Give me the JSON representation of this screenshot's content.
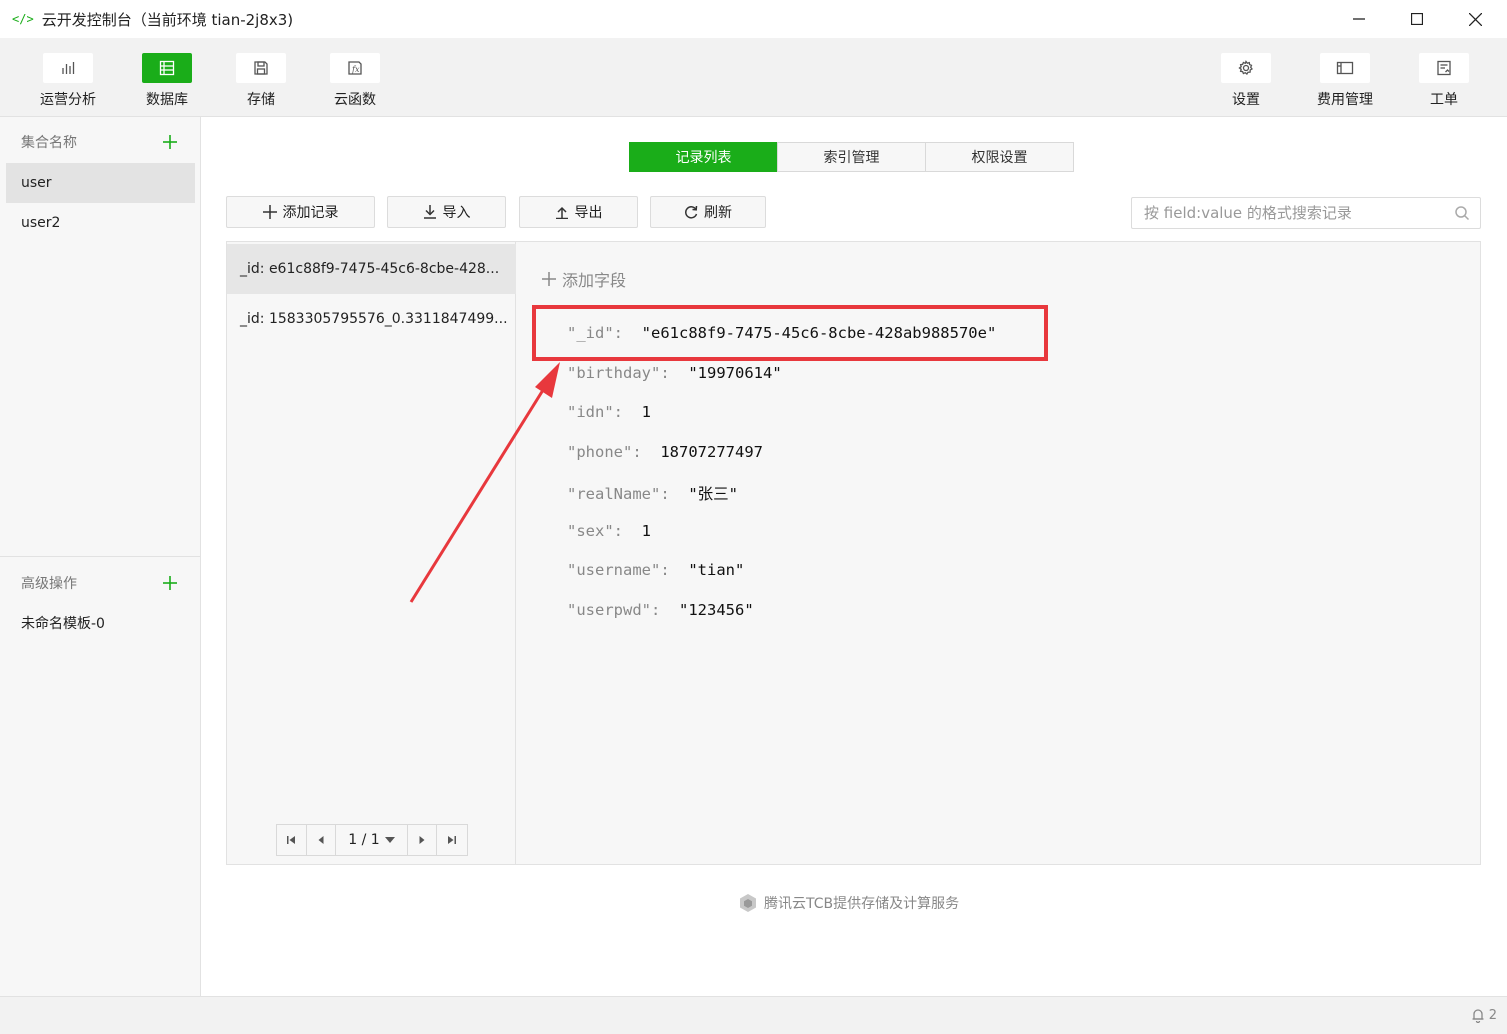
{
  "window": {
    "app_icon": "code-brackets-icon",
    "title": "云开发控制台（当前环境 tian-2j8x3)",
    "controls": {
      "minimize": "minimize-icon",
      "maximize": "maximize-icon",
      "close": "close-icon"
    }
  },
  "toolbar": {
    "left": [
      {
        "label": "运营分析",
        "icon": "bar-chart-icon",
        "active": false
      },
      {
        "label": "数据库",
        "icon": "database-icon",
        "active": true
      },
      {
        "label": "存储",
        "icon": "save-icon",
        "active": false
      },
      {
        "label": "云函数",
        "icon": "function-icon",
        "active": false
      }
    ],
    "right": [
      {
        "label": "设置",
        "icon": "gear-icon"
      },
      {
        "label": "费用管理",
        "icon": "billing-icon"
      },
      {
        "label": "工单",
        "icon": "ticket-icon"
      }
    ]
  },
  "sidebar": {
    "collections_title": "集合名称",
    "collections": [
      {
        "label": "user",
        "selected": true
      },
      {
        "label": "user2",
        "selected": false
      }
    ],
    "advanced_title": "高级操作",
    "advanced_items": [
      {
        "label": "未命名模板-0"
      }
    ]
  },
  "tabs": [
    {
      "label": "记录列表",
      "selected": true
    },
    {
      "label": "索引管理",
      "selected": false
    },
    {
      "label": "权限设置",
      "selected": false
    }
  ],
  "actions": {
    "add_record": "添加记录",
    "import": "导入",
    "export": "导出",
    "refresh": "刷新"
  },
  "search": {
    "placeholder": "按 field:value 的格式搜索记录"
  },
  "records": [
    {
      "label": "_id: e61c88f9-7475-45c6-8cbe-428...",
      "selected": true
    },
    {
      "label": "_id: 1583305795576_0.3311847499...",
      "selected": false
    }
  ],
  "pager": {
    "page": "1 / 1"
  },
  "detail": {
    "add_field": "添加字段",
    "fields": [
      {
        "key": "\"_id\"",
        "value": "\"e61c88f9-7475-45c6-8cbe-428ab988570e\""
      },
      {
        "key": "\"birthday\"",
        "value": "\"19970614\""
      },
      {
        "key": "\"idn\"",
        "value": "1"
      },
      {
        "key": "\"phone\"",
        "value": "18707277497"
      },
      {
        "key": "\"realName\"",
        "value": "\"张三\""
      },
      {
        "key": "\"sex\"",
        "value": "1"
      },
      {
        "key": "\"username\"",
        "value": "\"tian\""
      },
      {
        "key": "\"userpwd\"",
        "value": "\"123456\""
      }
    ]
  },
  "annotation": {
    "highlight_color": "#e8383d"
  },
  "footer": {
    "brand": "腾讯云TCB提供存储及计算服务"
  },
  "status": {
    "notifications": "2"
  },
  "colors": {
    "accent": "#1aad19"
  }
}
